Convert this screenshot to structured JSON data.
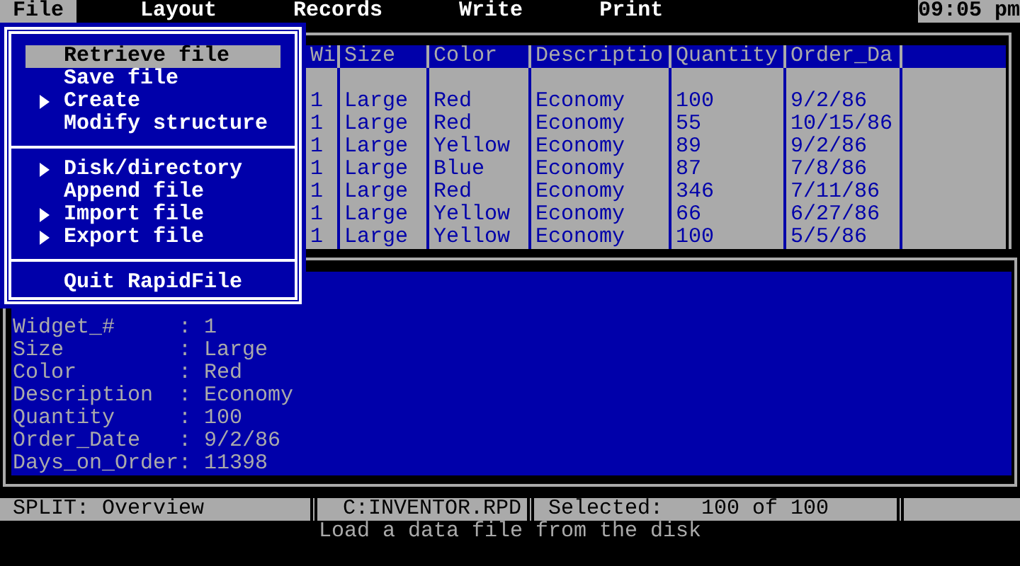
{
  "menu_bar": [
    {
      "label": "File",
      "selected": true
    },
    {
      "label": "Layout",
      "selected": false
    },
    {
      "label": "Records",
      "selected": false
    },
    {
      "label": "Write",
      "selected": false
    },
    {
      "label": "Print",
      "selected": false
    }
  ],
  "clock": "09:05 pm",
  "file_menu": {
    "groups": [
      [
        {
          "label": "Retrieve file",
          "submenu": false,
          "selected": true
        },
        {
          "label": "Save file",
          "submenu": false,
          "selected": false
        },
        {
          "label": "Create",
          "submenu": true,
          "selected": false
        },
        {
          "label": "Modify structure",
          "submenu": false,
          "selected": false
        }
      ],
      [
        {
          "label": "Disk/directory",
          "submenu": true,
          "selected": false
        },
        {
          "label": "Append file",
          "submenu": false,
          "selected": false
        },
        {
          "label": "Import file",
          "submenu": true,
          "selected": false
        },
        {
          "label": "Export file",
          "submenu": true,
          "selected": false
        }
      ],
      [
        {
          "label": "Quit RapidFile",
          "submenu": false,
          "selected": false
        }
      ]
    ]
  },
  "table": {
    "columns": [
      "Wi",
      "Size",
      "Color",
      "Descriptio",
      "Quantity",
      "Order_Da"
    ],
    "rows": [
      [
        "1",
        "Large",
        "Red",
        "Economy",
        "100",
        "9/2/86"
      ],
      [
        "1",
        "Large",
        "Red",
        "Economy",
        "55",
        "10/15/86"
      ],
      [
        "1",
        "Large",
        "Yellow",
        "Economy",
        "89",
        "9/2/86"
      ],
      [
        "1",
        "Large",
        "Blue",
        "Economy",
        "87",
        "7/8/86"
      ],
      [
        "1",
        "Large",
        "Red",
        "Economy",
        "346",
        "7/11/86"
      ],
      [
        "1",
        "Large",
        "Yellow",
        "Economy",
        "66",
        "6/27/86"
      ],
      [
        "1",
        "Large",
        "Yellow",
        "Economy",
        "100",
        "5/5/86"
      ]
    ]
  },
  "record": {
    "separator": ":",
    "fields": [
      {
        "name": "Widget_#",
        "value": "1"
      },
      {
        "name": "Size",
        "value": "Large"
      },
      {
        "name": "Color",
        "value": "Red"
      },
      {
        "name": "Description",
        "value": "Economy"
      },
      {
        "name": "Quantity",
        "value": "100"
      },
      {
        "name": "Order_Date",
        "value": "9/2/86"
      },
      {
        "name": "Days_on_Order",
        "value": "11398"
      }
    ]
  },
  "status_bar": {
    "mode": "SPLIT: Overview",
    "file": "C:INVENTOR.RPD",
    "selection": "Selected:   100 of 100"
  },
  "message": "Load a data file from the disk"
}
